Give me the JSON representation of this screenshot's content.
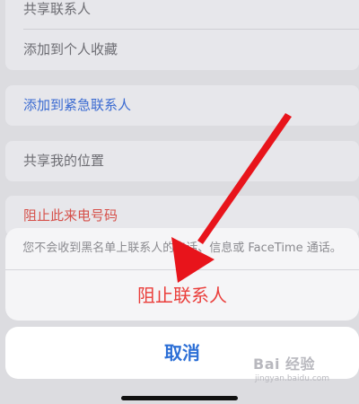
{
  "background_rows": {
    "group1": [
      "共享联系人",
      "添加到个人收藏"
    ],
    "group2": [
      "添加到紧急联系人"
    ],
    "group3": [
      "共享我的位置"
    ],
    "group4": [
      "阻止此来电号码"
    ]
  },
  "action_sheet": {
    "message": "您不会收到黑名单上联系人的电话、信息或 FaceTime 通话。",
    "block_label": "阻止联系人",
    "cancel_label": "取消"
  },
  "watermark": {
    "brand": "Bai 经验",
    "url": "jingyan.baidu.com"
  },
  "colors": {
    "destructive_red": "#ea3d3a",
    "system_blue": "#2c6fd6",
    "annotation_arrow": "#e8141b"
  },
  "icons": {
    "annotation": "red-arrow-icon"
  }
}
